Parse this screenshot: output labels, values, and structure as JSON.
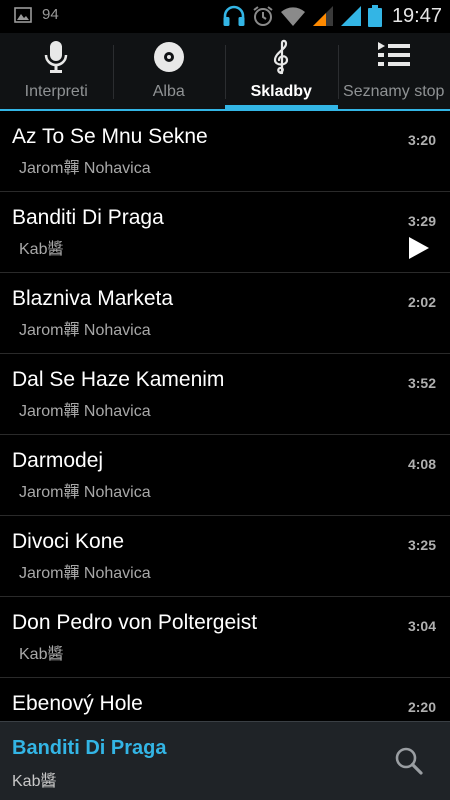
{
  "status_bar": {
    "left_icon": "image-icon",
    "notification_count": "94",
    "icons": [
      "headphones-icon",
      "alarm-icon",
      "wifi-icon",
      "signal-icon",
      "signal-icon",
      "battery-icon"
    ],
    "time": "19:47"
  },
  "tabs": [
    {
      "label": "Interpreti",
      "icon": "microphone-icon",
      "active": false
    },
    {
      "label": "Alba",
      "icon": "disc-icon",
      "active": false
    },
    {
      "label": "Skladby",
      "icon": "treble-clef-icon",
      "active": true
    },
    {
      "label": "Seznamy stop",
      "icon": "playlist-icon",
      "active": false
    }
  ],
  "songs": [
    {
      "title": "Az To Se Mnu Sekne",
      "artist": "Jarom韗 Nohavica",
      "duration": "3:20",
      "playing": false
    },
    {
      "title": "Banditi Di Praga",
      "artist": "Kab醬",
      "duration": "3:29",
      "playing": true
    },
    {
      "title": "Blazniva Marketa",
      "artist": "Jarom韗 Nohavica",
      "duration": "2:02",
      "playing": false
    },
    {
      "title": "Dal Se Haze Kamenim",
      "artist": "Jarom韗 Nohavica",
      "duration": "3:52",
      "playing": false
    },
    {
      "title": "Darmodej",
      "artist": "Jarom韗 Nohavica",
      "duration": "4:08",
      "playing": false
    },
    {
      "title": "Divoci Kone",
      "artist": "Jarom韗 Nohavica",
      "duration": "3:25",
      "playing": false
    },
    {
      "title": "Don Pedro von Poltergeist",
      "artist": "Kab醬",
      "duration": "3:04",
      "playing": false
    },
    {
      "title": "Ebenový Hole",
      "artist": "",
      "duration": "2:20",
      "playing": false
    }
  ],
  "now_playing": {
    "title": "Banditi Di Praga",
    "artist": "Kab醬",
    "search_icon": "search-icon"
  },
  "colors": {
    "accent": "#33b5e5",
    "status_green": "#33b5e5",
    "signal_orange": "#ff8a00"
  }
}
